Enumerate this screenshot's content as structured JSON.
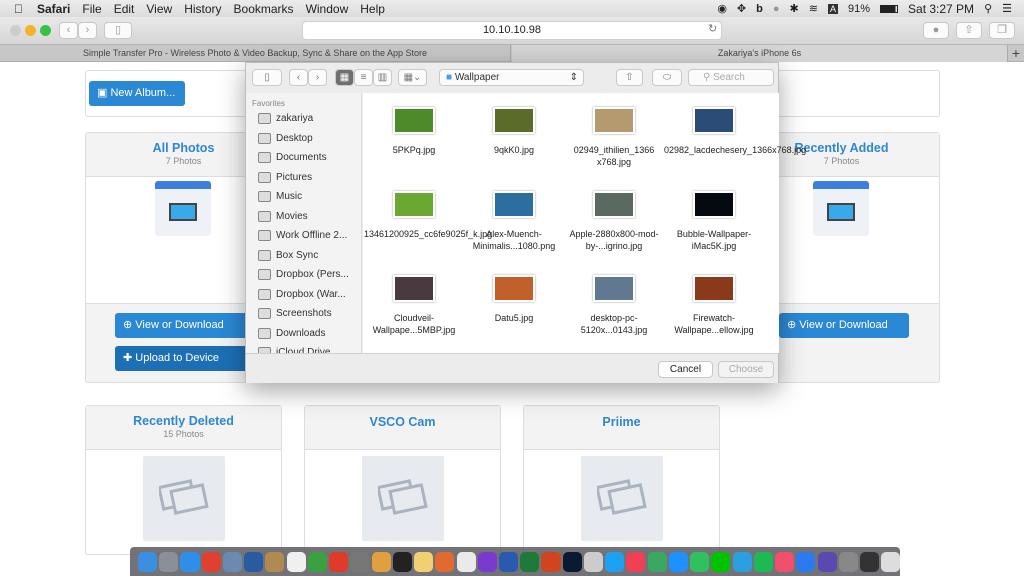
{
  "menubar": {
    "app": "Safari",
    "items": [
      "File",
      "Edit",
      "View",
      "History",
      "Bookmarks",
      "Window",
      "Help"
    ],
    "battery": "91%",
    "clock": "Sat 3:27 PM"
  },
  "browser": {
    "url": "10.10.10.98",
    "tabs": [
      {
        "label": "Simple Transfer Pro - Wireless Photo & Video Backup, Sync & Share on the App Store",
        "active": false
      },
      {
        "label": "Zakariya's iPhone 6s",
        "active": true
      }
    ],
    "new_tab": "+"
  },
  "page": {
    "new_album": "New Album...",
    "albums": [
      {
        "title": "All Photos",
        "count": "7 Photos",
        "view": "View or Download",
        "upload": "Upload to Device"
      },
      {
        "title": "Recently Added",
        "count": "7 Photos",
        "view": "View or Download"
      },
      {
        "title": "Recently Deleted",
        "count": "15 Photos"
      },
      {
        "title": "VSCO Cam",
        "count": ""
      },
      {
        "title": "Priime",
        "count": ""
      }
    ]
  },
  "dialog": {
    "location": "Wallpaper",
    "search_placeholder": "Search",
    "sidebar_heading": "Favorites",
    "sidebar": [
      {
        "label": "zakariya",
        "icon": "home-icon"
      },
      {
        "label": "Desktop",
        "icon": "desktop-icon"
      },
      {
        "label": "Documents",
        "icon": "documents-icon"
      },
      {
        "label": "Pictures",
        "icon": "camera-icon"
      },
      {
        "label": "Music",
        "icon": "music-icon"
      },
      {
        "label": "Movies",
        "icon": "film-icon"
      },
      {
        "label": "Work Offline 2...",
        "icon": "folder-icon"
      },
      {
        "label": "Box Sync",
        "icon": "folder-icon"
      },
      {
        "label": "Dropbox (Pers...",
        "icon": "folder-icon"
      },
      {
        "label": "Dropbox (War...",
        "icon": "folder-icon"
      },
      {
        "label": "Screenshots",
        "icon": "folder-icon"
      },
      {
        "label": "Downloads",
        "icon": "download-icon"
      },
      {
        "label": "iCloud Drive",
        "icon": "cloud-icon"
      }
    ],
    "files": [
      {
        "name": "5PKPq.jpg",
        "color": "#4c8a2a"
      },
      {
        "name": "9qkK0.jpg",
        "color": "#5b6b2a"
      },
      {
        "name": "02949_ithilien_1366 x768.jpg",
        "color": "#b59a70"
      },
      {
        "name": "02982_lacdechesery_1366x768.jpg",
        "color": "#2c4c78"
      },
      {
        "name": "13461200925_cc6fe9025f_k.jpg",
        "color": "#6aa832"
      },
      {
        "name": "Alex-Muench-Minimalis...1080.png",
        "color": "#2c6ea0"
      },
      {
        "name": "Apple-2880x800-mod-by-...igrino.jpg",
        "color": "#5a6a60"
      },
      {
        "name": "Bubble-Wallpaper-iMac5K.jpg",
        "color": "#050a12"
      },
      {
        "name": "Cloudveil-Wallpape...5MBP.jpg",
        "color": "#4a3a40"
      },
      {
        "name": "Datu5.jpg",
        "color": "#c0602a"
      },
      {
        "name": "desktop-pc-5120x...0143.jpg",
        "color": "#607890"
      },
      {
        "name": "Firewatch-Wallpape...ellow.jpg",
        "color": "#8a3a1a"
      }
    ],
    "cancel": "Cancel",
    "choose": "Choose"
  },
  "dock": [
    "#3b8fe0",
    "#8a8f99",
    "#2f8fe8",
    "#e04030",
    "#6a8ab0",
    "#2a5aa0",
    "#b08a50",
    "#f0f0f0",
    "#3aa040",
    "#e03a2a",
    "#777",
    "#e0a040",
    "#222",
    "#f0d070",
    "#e06a30",
    "#eaeaea",
    "#7a3ad0",
    "#2a5ab0",
    "#1f7a3a",
    "#d0441f",
    "#0a1a30",
    "#ccc",
    "#1da1f2",
    "#ef4056",
    "#3aa860",
    "#1e90ff",
    "#30c060",
    "#00c300",
    "#2aa0e0",
    "#1db954",
    "#f0506e",
    "#2a7af0",
    "#5a4ab0",
    "#888",
    "#333",
    "#ddd"
  ]
}
